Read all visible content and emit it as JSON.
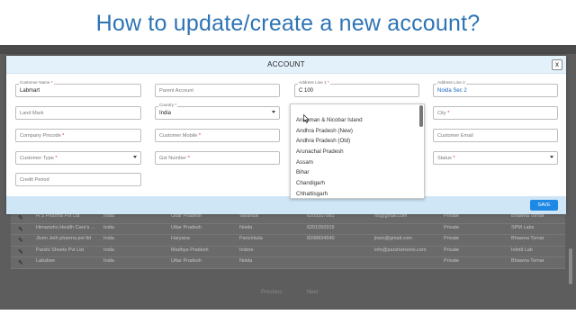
{
  "slide": {
    "title": "How to update/create a new account?"
  },
  "modal": {
    "title": "ACCOUNT",
    "close_label": "x",
    "save_label": "SAVE",
    "fields": {
      "customer_name": {
        "label": "Customer Name",
        "required": "*",
        "value": "Labmart"
      },
      "parent_account": {
        "placeholder": "Parent Account"
      },
      "address_line_1": {
        "label": "Address Line 1",
        "required": "*",
        "value": "C 100"
      },
      "address_line_2": {
        "label": "Address Line 2",
        "value": "Noida Sec 2"
      },
      "land_mark": {
        "placeholder": "Land Mark"
      },
      "country": {
        "label": "Country",
        "required": "*",
        "value": "India"
      },
      "city": {
        "placeholder": "City",
        "required": "*"
      },
      "company_pincode": {
        "placeholder": "Company Pincode",
        "required": "*"
      },
      "customer_mobile": {
        "placeholder": "Customer Mobile",
        "required": "*"
      },
      "customer_email": {
        "placeholder": "Customer Email"
      },
      "customer_type": {
        "placeholder": "Customer Type",
        "required": "*"
      },
      "gst_number": {
        "placeholder": "Gst Number",
        "required": "*"
      },
      "status": {
        "placeholder": "Status",
        "required": "*"
      },
      "credit_period": {
        "placeholder": "Credit Period"
      }
    }
  },
  "state_dropdown": {
    "options": [
      "Andaman & Nicobar Island",
      "Andhra Pradesh (New)",
      "Andhra Pradesh (Old)",
      "Arunachal Pradesh",
      "Assam",
      "Bihar",
      "Chandigarh",
      "Chhattisgarh"
    ]
  },
  "background_table": {
    "rows": [
      [
        "H S Pharma Pvt Ltd",
        "India",
        "Uttar Pradesh",
        "Varanasi",
        "6205557981",
        "hs@gmail.com",
        "Private",
        "Bhawna Tomar"
      ],
      [
        "Himanshu Health Care's ...",
        "India",
        "Uttar Pradesh",
        "Noida",
        "6201050315",
        "",
        "Private",
        "SPM Labs"
      ],
      [
        "Jiven Jeth pharma pvt ltd",
        "India",
        "Haryana",
        "Panchkula",
        "8298834540",
        "jiven@gmail.com",
        "Private",
        "Bhawna Tomar"
      ],
      [
        "Parshi Sheets Pvt Ltd",
        "India",
        "Madhya Pradesh",
        "Indore",
        "",
        "info@parshisheets.com",
        "Private",
        "Infotil Lab"
      ],
      [
        "Labsbee",
        "India",
        "Uttar Pradesh",
        "Noida",
        "",
        "",
        "Private",
        "Bhawna Tomar"
      ]
    ],
    "pager": [
      "Previous",
      "Next"
    ]
  },
  "colors": {
    "title_blue": "#2e74b5",
    "save_blue": "#1e88e5",
    "header_bg": "#e3f1fb",
    "footer_bg": "#cfe6f7"
  }
}
